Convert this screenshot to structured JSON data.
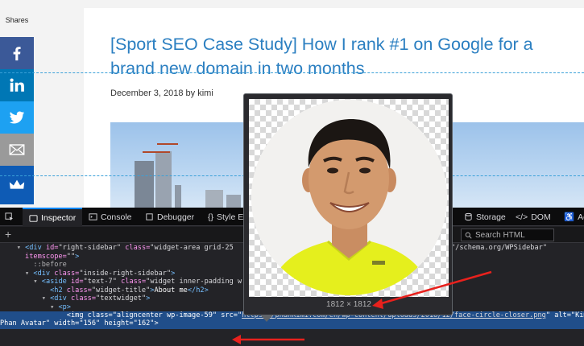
{
  "page": {
    "shares_label": "Shares",
    "post_title": "[Sport SEO Case Study] How I rank #1 on Google for a brand new domain in two months",
    "post_meta": "December 3, 2018 by kimi",
    "share_buttons": [
      {
        "icon": "facebook-icon",
        "color": "#3b5998"
      },
      {
        "icon": "linkedin-icon",
        "color": "#0077b5"
      },
      {
        "icon": "twitter-icon",
        "color": "#1da1f2"
      },
      {
        "icon": "email-icon",
        "color": "#9a9a9a"
      },
      {
        "icon": "sumome-crown-icon",
        "color": "#0e5bb5"
      }
    ]
  },
  "devtools": {
    "tabs": {
      "inspector": "Inspector",
      "console": "Console",
      "debugger": "Debugger",
      "style_editor": "Style E",
      "storage": "Storage",
      "dom": "DOM",
      "accessibility": "Ac"
    },
    "add_node_label": "+",
    "search_placeholder": "Search HTML",
    "code": {
      "l1_tag": "<div",
      "l1_a1": " id=",
      "l1_v1": "\"right-sidebar\"",
      "l1_a2": " class=",
      "l1_v2": "\"widget-area grid-25",
      "l1_tail": "\"/schema.org/WPSidebar\"",
      "l2_a": "itemscope=",
      "l2_v": "\"\"",
      "l2_close": ">",
      "l3": "::before",
      "l4_tag": "<div",
      "l4_a": " class=",
      "l4_v": "\"inside-right-sidebar\"",
      "l4_close": ">",
      "l5_tag": "<aside",
      "l5_a1": " id=",
      "l5_v1": "\"text-7\"",
      "l5_a2": " class=",
      "l5_v2": "\"widget inner-padding w",
      "l6_tag": "<h2",
      "l6_a": " class=",
      "l6_v": "\"widget-title\"",
      "l6_open_close": ">",
      "l6_text": "About me",
      "l6_end": "</h2>",
      "l7_tag": "<div",
      "l7_a": " class=",
      "l7_v": "\"textwidget\"",
      "l7_close": ">",
      "l8": "<p>",
      "l9_tag": "<img",
      "l9_a1": " class=",
      "l9_v1": "\"aligncenter wp-image-59\"",
      "l9_a2": " src=",
      "l9_q1": "\"",
      "l9_url": "https://phankimi.com/en/wp-content/uploads/2018/12/face-circle-closer.png",
      "l9_q2": "\"",
      "l9_a3": " alt=",
      "l9_v3": "\"Kimi",
      "l10_v": "Phan Avatar\"",
      "l10_a1": " width=",
      "l10_v1": "\"156\"",
      "l10_a2": " height=",
      "l10_v2": "\"162\"",
      "l10_close": ">"
    }
  },
  "tooltip": {
    "dimensions": "1812 × 1812"
  },
  "colors": {
    "accent": "#0a84ff",
    "link_title": "#2b7fc1",
    "annotation_red": "#e8211d",
    "avatar_shirt": "#e8f21e"
  }
}
